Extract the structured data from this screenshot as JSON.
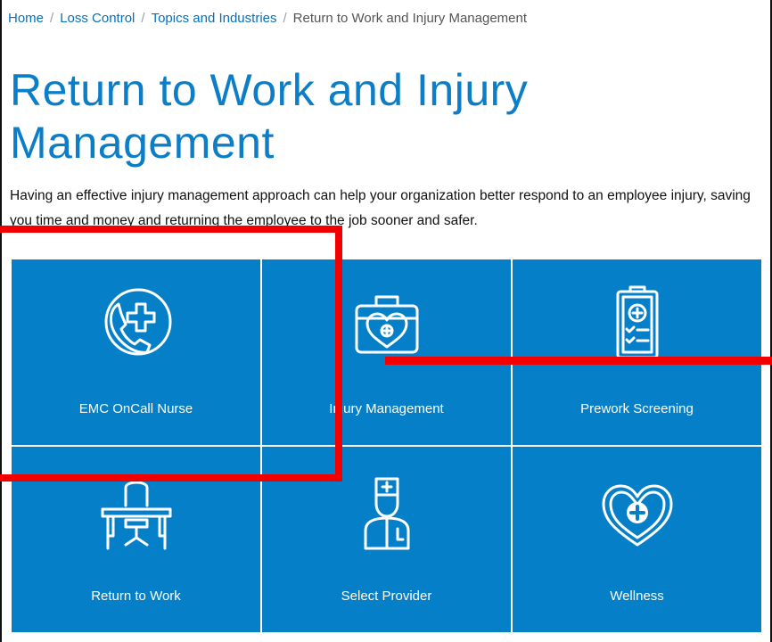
{
  "breadcrumb": {
    "home": "Home",
    "loss_control": "Loss Control",
    "topics": "Topics and Industries",
    "current": "Return to Work and Injury Management",
    "separator": "/"
  },
  "page": {
    "title": "Return to Work and Injury Management",
    "intro": "Having an effective injury management approach can help your organization better respond to an employee injury, saving you time and money and returning the employee to the job sooner and safer."
  },
  "tiles": [
    {
      "label": "EMC OnCall Nurse",
      "icon": "phone-medical-cross-icon"
    },
    {
      "label": "Injury Management",
      "icon": "medical-kit-heart-icon"
    },
    {
      "label": "Prework Screening",
      "icon": "clipboard-checklist-icon"
    },
    {
      "label": "Return to Work",
      "icon": "desk-chair-icon"
    },
    {
      "label": "Select Provider",
      "icon": "doctor-icon"
    },
    {
      "label": "Wellness",
      "icon": "heart-plus-icon"
    }
  ],
  "colors": {
    "tile_bg": "#0580c8",
    "link": "#0a6fba",
    "title": "#0b7ec7",
    "annotation": "#f20000"
  }
}
